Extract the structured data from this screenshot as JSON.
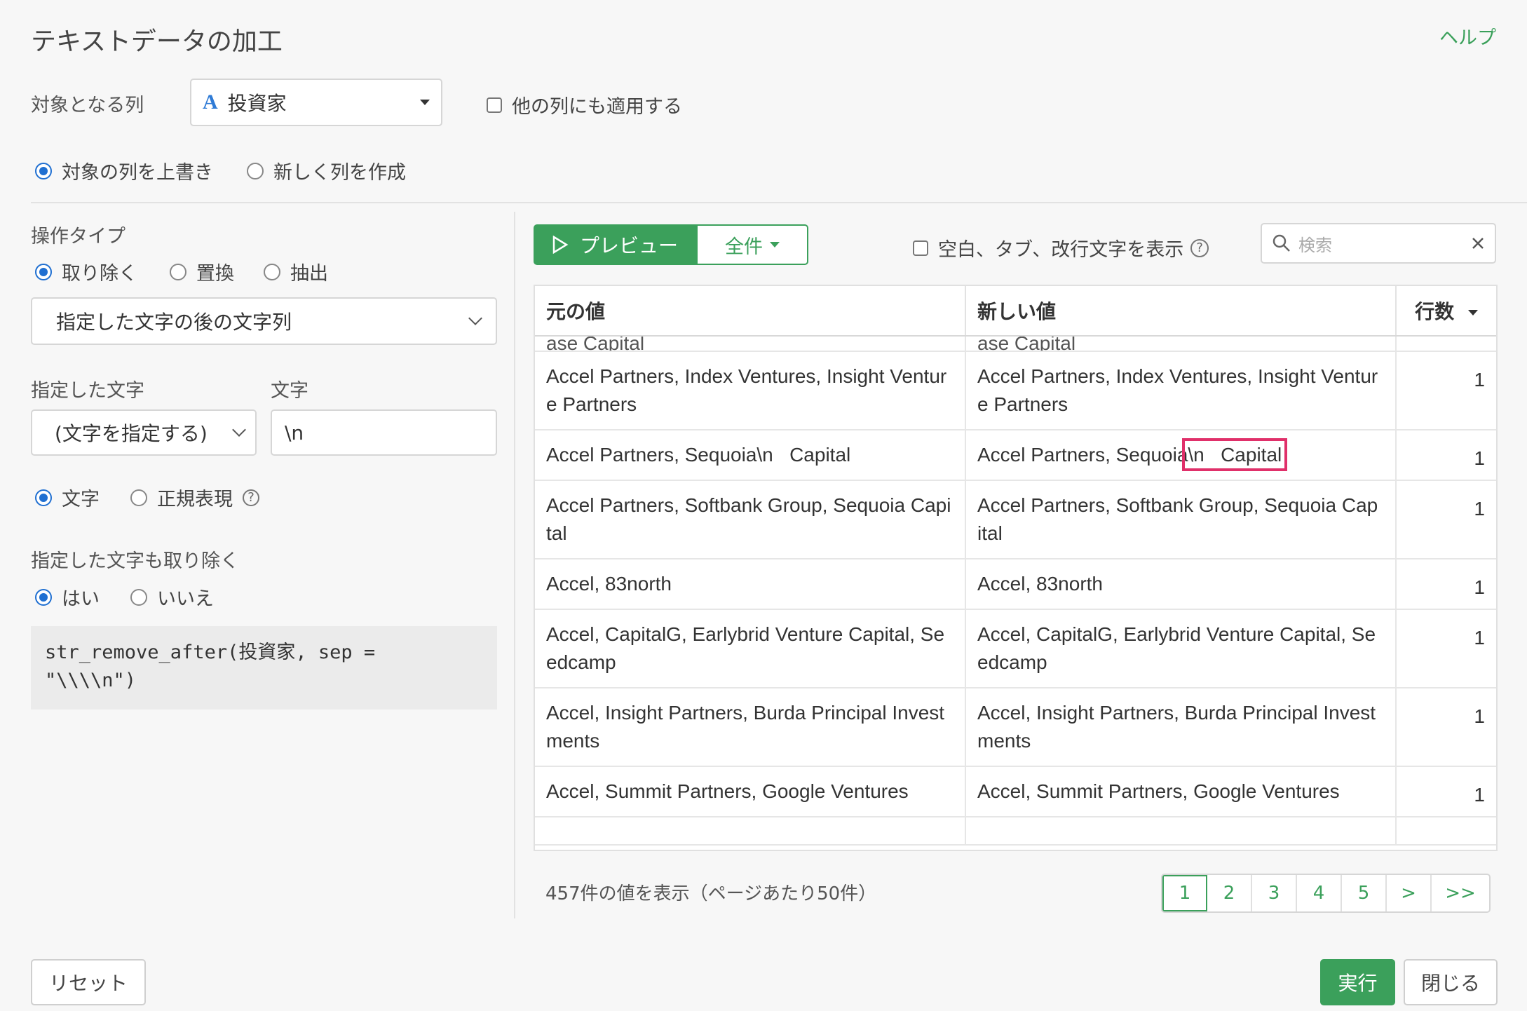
{
  "title": "テキストデータの加工",
  "help": "ヘルプ",
  "target": {
    "label": "対象となる列",
    "type_glyph": "A",
    "column": "投資家",
    "apply_others": "他の列にも適用する"
  },
  "output_mode": {
    "overwrite": "対象の列を上書き",
    "new_column": "新しく列を作成"
  },
  "operation": {
    "label": "操作タイプ",
    "remove": "取り除く",
    "replace": "置換",
    "extract": "抽出",
    "method": "指定した文字の後の文字列"
  },
  "specified": {
    "label": "指定した文字",
    "char_label": "文字",
    "select": "(文字を指定する)",
    "value": "\\n",
    "kind_text": "文字",
    "kind_regex": "正規表現",
    "help_glyph": "?"
  },
  "remove_delim": {
    "label": "指定した文字も取り除く",
    "yes": "はい",
    "no": "いいえ"
  },
  "code": "str_remove_after(投資家, sep =\n\"\\\\\\\\n\")",
  "toolbar": {
    "preview": "プレビュー",
    "all": "全件",
    "show_whitespace": "空白、タブ、改行文字を表示",
    "help_glyph": "?",
    "search_placeholder": "検索"
  },
  "table": {
    "headers": {
      "original": "元の値",
      "new": "新しい値",
      "count": "行数"
    },
    "cut_top": {
      "original": "ase Capital",
      "new": "ase Capital"
    },
    "rows": [
      {
        "original": "Accel Partners, Index Ventures, Insight Ventur e Partners",
        "new": "Accel Partners, Index Ventures, Insight Ventur e Partners",
        "count": "1"
      },
      {
        "original": "Accel Partners, Sequoia\\n   Capital",
        "new_pre": "Accel Partners, Sequoia",
        "new_hl": "\\n   Capital",
        "count": "1"
      },
      {
        "original": "Accel Partners, Softbank Group, Sequoia Capi tal",
        "new": "Accel Partners, Softbank Group, Sequoia Cap ital",
        "count": "1"
      },
      {
        "original": "Accel, 83north",
        "new": "Accel, 83north",
        "count": "1"
      },
      {
        "original": "Accel, CapitalG, Earlybrid Venture Capital, Se edcamp",
        "new": "Accel, CapitalG, Earlybrid Venture Capital, Se edcamp",
        "count": "1"
      },
      {
        "original": "Accel, Insight Partners, Burda Principal Invest ments",
        "new": "Accel, Insight Partners, Burda Principal Invest ments",
        "count": "1"
      },
      {
        "original": "Accel, Summit Partners, Google Ventures",
        "new": "Accel, Summit Partners, Google Ventures",
        "count": "1"
      }
    ]
  },
  "footer": {
    "info": "457件の値を表示（ページあたり50件）",
    "pages": [
      "1",
      "2",
      "3",
      "4",
      "5",
      ">",
      ">>"
    ]
  },
  "buttons": {
    "reset": "リセット",
    "run": "実行",
    "close": "閉じる"
  },
  "colors": {
    "accent_green": "#3ba05b",
    "radio_blue": "#1f6fd1",
    "highlight": "#e0306a"
  }
}
